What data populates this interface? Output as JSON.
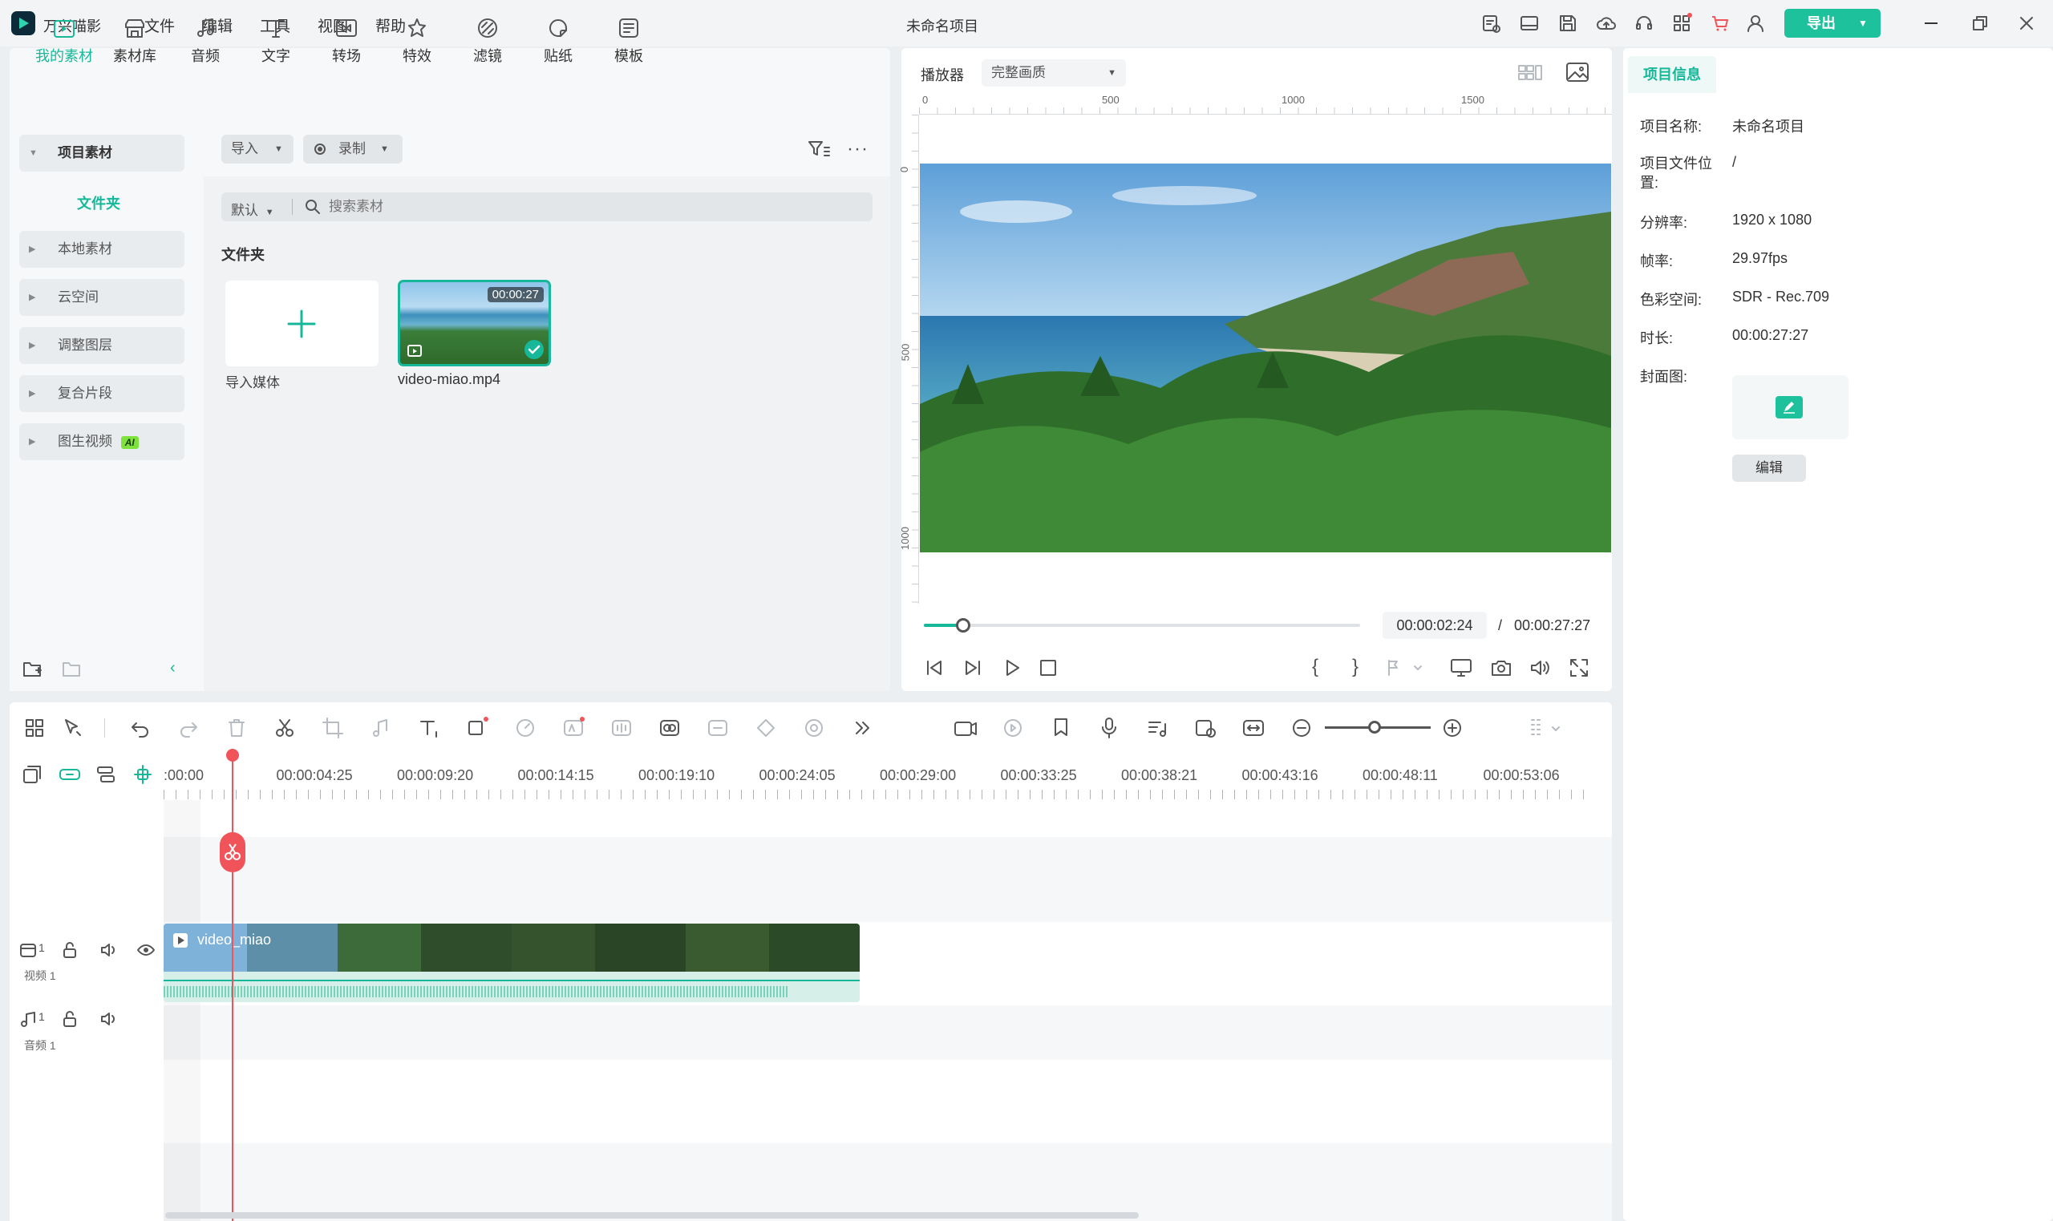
{
  "app": {
    "name": "万兴喵影",
    "project_title": "未命名项目",
    "export_label": "导出"
  },
  "menu": [
    "文件",
    "编辑",
    "工具",
    "视图",
    "帮助"
  ],
  "toolbar_tabs": [
    {
      "label": "我的素材",
      "icon": "my-media-icon",
      "active": true
    },
    {
      "label": "素材库",
      "icon": "stock-library-icon"
    },
    {
      "label": "音频",
      "icon": "audio-icon"
    },
    {
      "label": "文字",
      "icon": "text-icon"
    },
    {
      "label": "转场",
      "icon": "transition-icon"
    },
    {
      "label": "特效",
      "icon": "effects-icon"
    },
    {
      "label": "滤镜",
      "icon": "filter-icon"
    },
    {
      "label": "贴纸",
      "icon": "sticker-icon"
    },
    {
      "label": "模板",
      "icon": "template-icon"
    }
  ],
  "sidebar": {
    "project_media": "项目素材",
    "folder": "文件夹",
    "items": [
      "本地素材",
      "云空间",
      "调整图层",
      "复合片段",
      "图生视频"
    ],
    "ai_badge": "AI"
  },
  "media": {
    "import_label": "导入",
    "record_label": "录制",
    "sort_label": "默认",
    "search_placeholder": "搜索素材",
    "section_title": "文件夹",
    "import_tile_label": "导入媒体",
    "clip_name": "video-miao.mp4",
    "clip_duration": "00:00:27"
  },
  "player": {
    "label": "播放器",
    "quality": "完整画质",
    "ruler_h": [
      "0",
      "500",
      "1000",
      "1500"
    ],
    "ruler_v": [
      "0",
      "500",
      "1000"
    ],
    "current_time": "00:00:02:24",
    "separator": "/",
    "total_time": "00:00:27:27",
    "progress": 0.09
  },
  "project_info": {
    "tab": "项目信息",
    "rows": [
      {
        "label": "项目名称:",
        "value": "未命名项目"
      },
      {
        "label": "项目文件位置:",
        "value": "/"
      },
      {
        "label": "分辨率:",
        "value": "1920 x 1080"
      },
      {
        "label": "帧率:",
        "value": "29.97fps"
      },
      {
        "label": "色彩空间:",
        "value": "SDR - Rec.709"
      },
      {
        "label": "时长:",
        "value": "00:00:27:27"
      },
      {
        "label": "封面图:",
        "value": ""
      }
    ],
    "edit_label": "编辑"
  },
  "timeline": {
    "ticks": [
      ":00:00",
      "00:00:04:25",
      "00:00:09:20",
      "00:00:14:15",
      "00:00:19:10",
      "00:00:24:05",
      "00:00:29:00",
      "00:00:33:25",
      "00:00:38:21",
      "00:00:43:16",
      "00:00:48:11",
      "00:00:53:06"
    ],
    "video_track": {
      "index": "1",
      "name": "视频 1"
    },
    "audio_track": {
      "index": "1",
      "name": "音频 1"
    },
    "clip_label": "video_miao"
  },
  "colors": {
    "accent": "#17b89a",
    "playhead": "#f0545a",
    "export_bg": "#1dc29d"
  }
}
